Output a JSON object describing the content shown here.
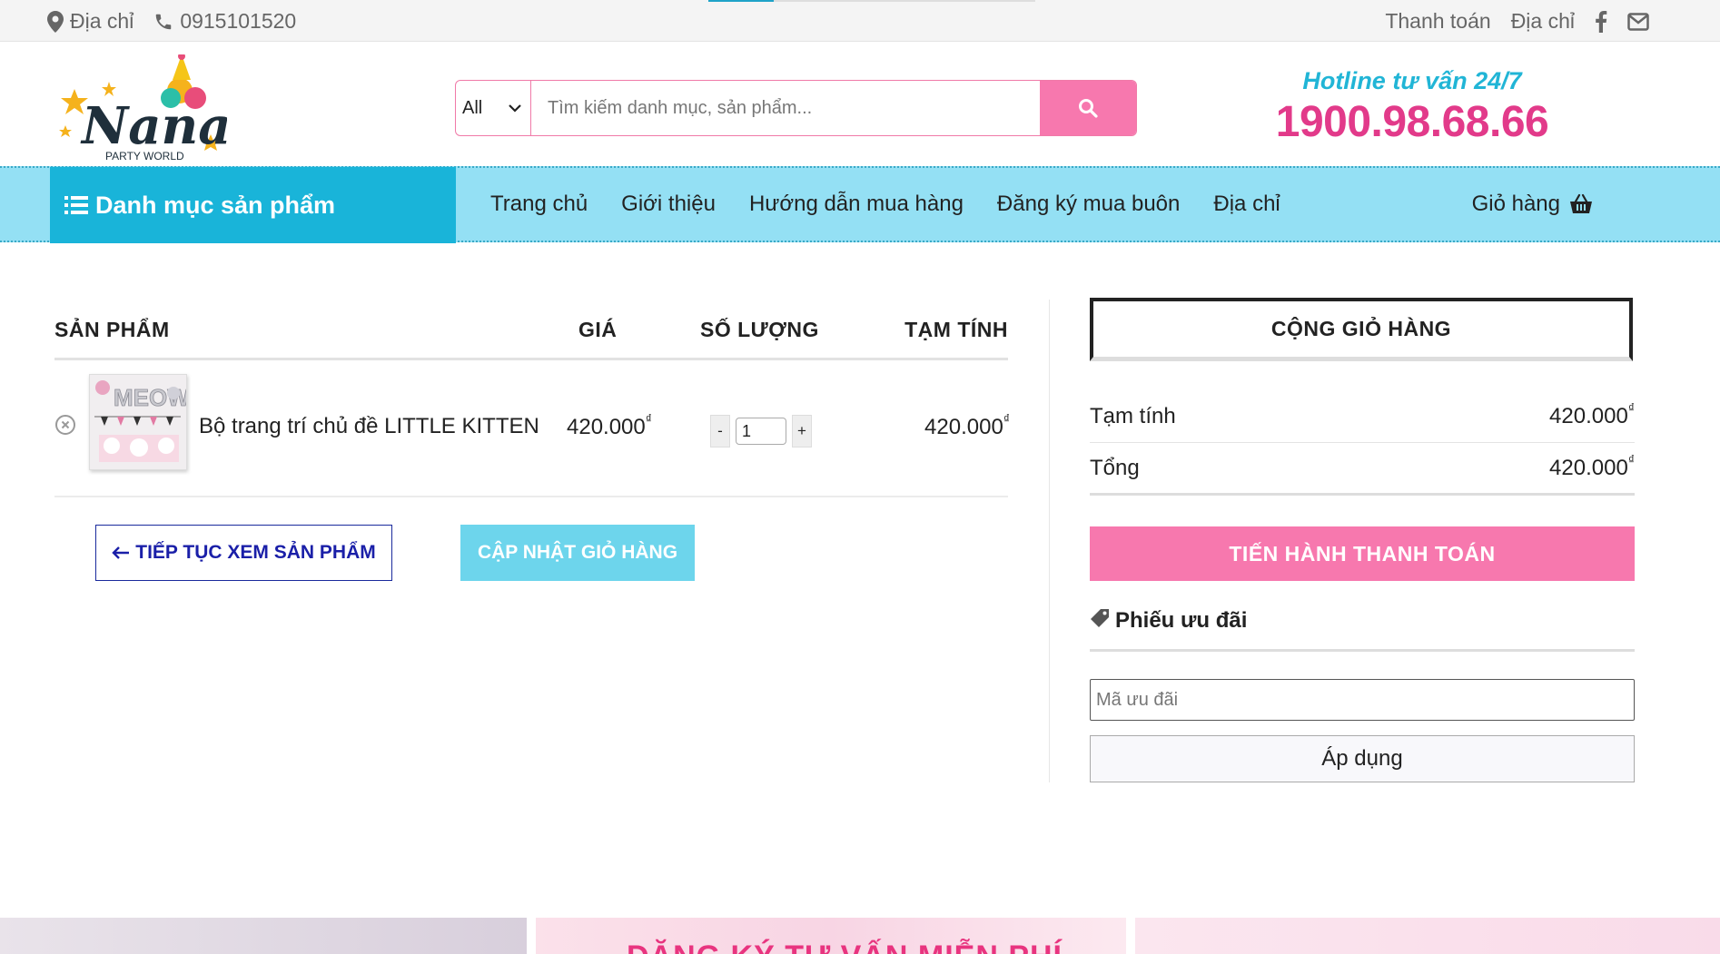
{
  "topbar": {
    "address": "Địa chỉ",
    "phone": "0915101520",
    "links": [
      "Thanh toán",
      "Địa chỉ"
    ]
  },
  "header": {
    "logo_text": "Nana",
    "logo_sub": "PARTY WORLD",
    "search": {
      "category": "All",
      "placeholder": "Tìm kiếm danh mục, sản phẩm..."
    },
    "hotline_label": "Hotline tư vấn 24/7",
    "hotline_number": "1900.98.68.66"
  },
  "nav": {
    "category_menu": "Danh mục sản phẩm",
    "links": [
      "Trang chủ",
      "Giới thiệu",
      "Hướng dẫn mua hàng",
      "Đăng ký mua buôn",
      "Địa chỉ"
    ],
    "cart": "Giỏ hàng"
  },
  "cart": {
    "headers": {
      "product": "SẢN PHẨM",
      "price": "GIÁ",
      "quantity": "SỐ LƯỢNG",
      "subtotal": "TẠM TÍNH"
    },
    "items": [
      {
        "name": "Bộ trang trí chủ đề LITTLE KITTEN",
        "price": "420.000",
        "quantity": "1",
        "subtotal": "420.000"
      }
    ],
    "currency": "₫",
    "qty_minus": "-",
    "qty_plus": "+",
    "continue_button": "TIẾP TỤC XEM SẢN PHẨM",
    "update_button": "CẬP NHẬT GIỎ HÀNG"
  },
  "totals": {
    "title": "CỘNG GIỎ HÀNG",
    "subtotal_label": "Tạm tính",
    "subtotal_value": "420.000",
    "total_label": "Tổng",
    "total_value": "420.000",
    "checkout_button": "TIẾN HÀNH THANH TOÁN",
    "coupon_title": "Phiếu ưu đãi",
    "coupon_placeholder": "Mã ưu đãi",
    "apply_button": "Áp dụng"
  },
  "footer": {
    "banner_text": "ĐĂNG KÝ TƯ VẤN MIỄN PHÍ"
  },
  "colors": {
    "pink": "#f778ae",
    "cyan": "#19b4d9",
    "nav_bg": "#94e0f4",
    "hotline": "#e23a8a"
  }
}
